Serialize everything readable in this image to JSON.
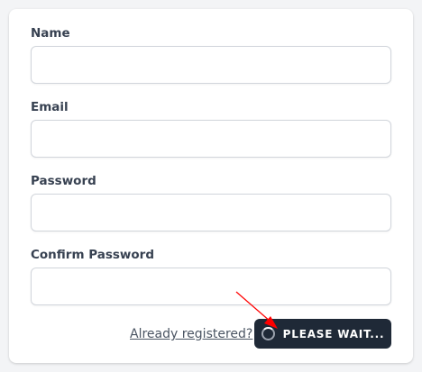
{
  "form": {
    "name": {
      "label": "Name",
      "value": "",
      "placeholder": ""
    },
    "email": {
      "label": "Email",
      "value": "",
      "placeholder": ""
    },
    "password": {
      "label": "Password",
      "value": "",
      "placeholder": ""
    },
    "confirm_password": {
      "label": "Confirm Password",
      "value": "",
      "placeholder": ""
    }
  },
  "footer": {
    "login_link_label": "Already registered?",
    "submit_label": "PLEASE WAIT..."
  },
  "colors": {
    "button_bg": "#1f2937",
    "annotation_arrow": "#ff0000"
  },
  "icons": {
    "spinner": "loading-spinner-icon",
    "arrow": "annotation-arrow-icon"
  }
}
